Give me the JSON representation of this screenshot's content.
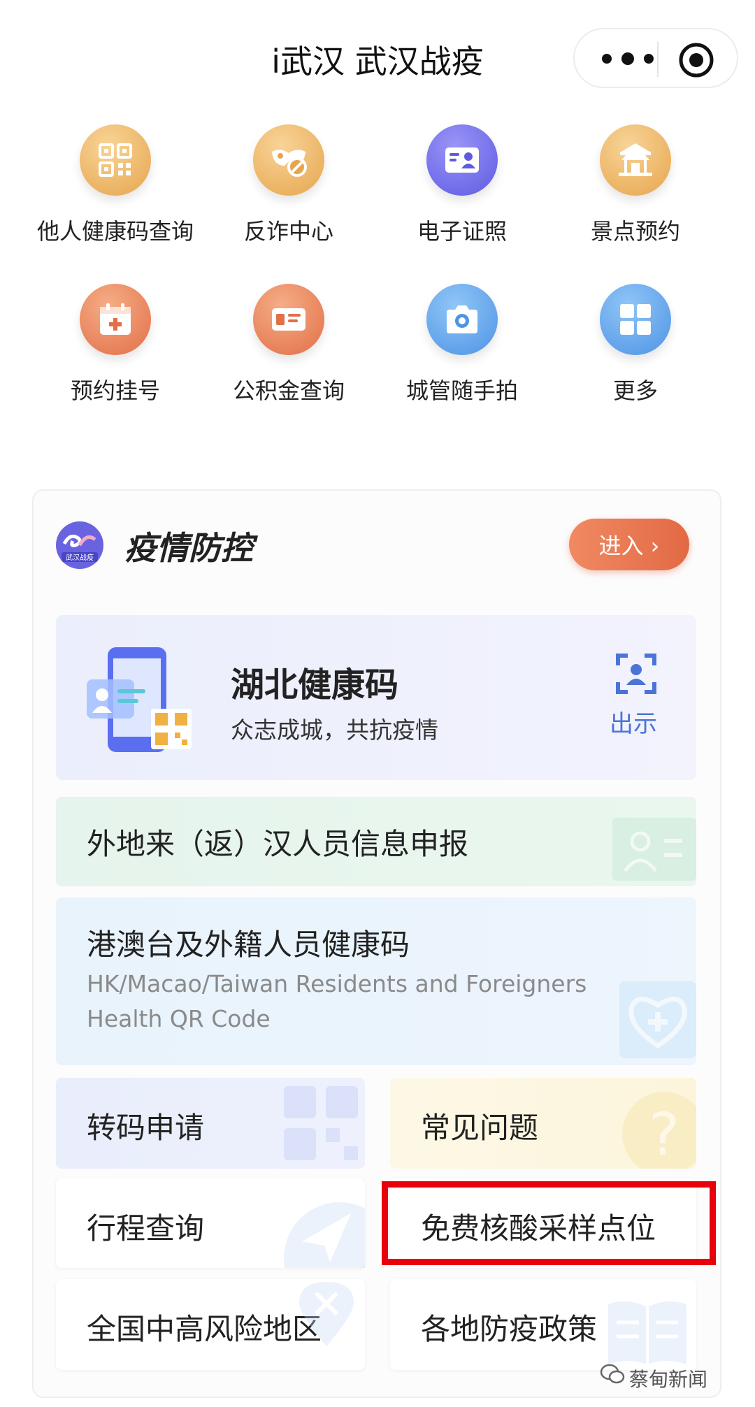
{
  "header": {
    "title": "i武汉 武汉战疫"
  },
  "grid": [
    {
      "label": "他人健康码查询",
      "icon": "qr-code-icon"
    },
    {
      "label": "反诈中心",
      "icon": "mask-block-icon"
    },
    {
      "label": "电子证照",
      "icon": "id-card-icon"
    },
    {
      "label": "景点预约",
      "icon": "pavilion-icon"
    },
    {
      "label": "预约挂号",
      "icon": "calendar-plus-icon"
    },
    {
      "label": "公积金查询",
      "icon": "fund-card-icon"
    },
    {
      "label": "城管随手拍",
      "icon": "camera-icon"
    },
    {
      "label": "更多",
      "icon": "grid-more-icon"
    }
  ],
  "card": {
    "title": "疫情防控",
    "logo_text": "武汉战疫",
    "enter_label": "进入 ›",
    "health_code": {
      "title": "湖北健康码",
      "subtitle": "众志成城，共抗疫情",
      "action": "出示"
    },
    "declare": {
      "label": "外地来（返）汉人员信息申报"
    },
    "foreign": {
      "label": "港澳台及外籍人员健康码",
      "en_line1": "HK/Macao/Taiwan Residents and Foreigners",
      "en_line2": "Health QR Code"
    },
    "transfer": {
      "label": "转码申请"
    },
    "faq": {
      "label": "常见问题"
    },
    "trip": {
      "label": "行程查询"
    },
    "testing": {
      "label": "免费核酸采样点位"
    },
    "risk": {
      "label": "全国中高风险地区"
    },
    "policy": {
      "label": "各地防疫政策"
    }
  },
  "watermark": {
    "text": "蔡甸新闻"
  },
  "colors": {
    "highlight": "#e8000a",
    "accent_orange": "#e26a45",
    "accent_blue": "#4a74d6"
  }
}
